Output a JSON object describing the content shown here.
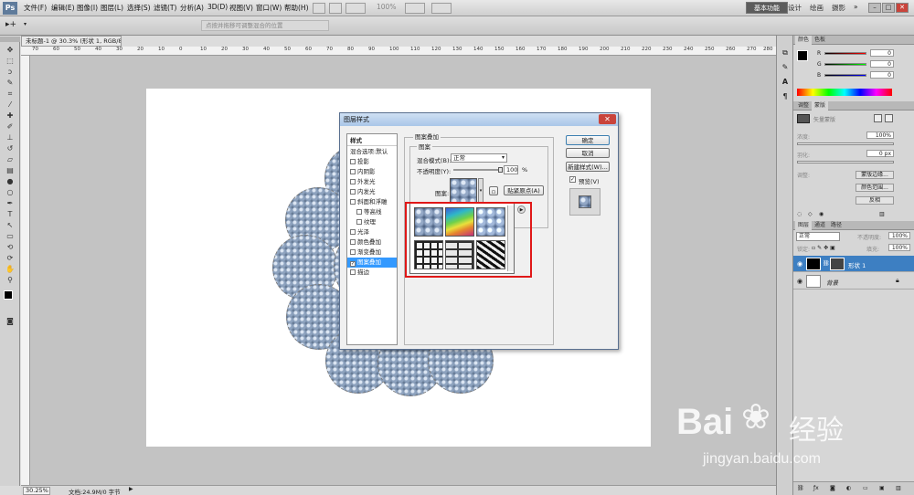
{
  "menubar": {
    "app_logo": "Ps",
    "items": [
      "文件(F)",
      "编辑(E)",
      "图像(I)",
      "图层(L)",
      "选择(S)",
      "滤镜(T)",
      "分析(A)",
      "3D(D)",
      "视图(V)",
      "窗口(W)",
      "帮助(H)"
    ],
    "zoom_value": "100%",
    "workspace": "基本功能",
    "workspace_items": [
      "设计",
      "绘画",
      "摄影"
    ],
    "more": "»"
  },
  "optionsbar": {
    "hint": "点按并拖移可调整混合的位置"
  },
  "toolbar": {
    "tools": [
      "move-tool",
      "marquee-tool",
      "lasso-tool",
      "quick-select-tool",
      "crop-tool",
      "eyedropper-tool",
      "healing-tool",
      "brush-tool",
      "stamp-tool",
      "history-brush-tool",
      "eraser-tool",
      "gradient-tool",
      "blur-tool",
      "dodge-tool",
      "pen-tool",
      "type-tool",
      "path-select-tool",
      "shape-tool",
      "3d-rotate-tool",
      "3d-orbit-tool",
      "hand-tool",
      "zoom-tool"
    ]
  },
  "document": {
    "tab_title": "未标题-1 @ 30.3% (形状 1, RGB/8) *",
    "ruler_ticks": [
      "70",
      "60",
      "50",
      "40",
      "30",
      "20",
      "10",
      "0",
      "10",
      "20",
      "30",
      "40",
      "50",
      "60",
      "70",
      "80",
      "90",
      "100",
      "110",
      "120",
      "130",
      "140",
      "150",
      "160",
      "170",
      "180",
      "190",
      "200",
      "210",
      "220",
      "230",
      "240",
      "250",
      "260",
      "270",
      "280"
    ],
    "zoom": "30.25%",
    "doc_info": "文档:24.9M/0 字节"
  },
  "dialog": {
    "title": "图层样式",
    "close": "✕",
    "styles_header": "样式",
    "blend_default": "混合选项:默认",
    "style_items": [
      {
        "label": "投影",
        "checked": false,
        "indent": false
      },
      {
        "label": "内阴影",
        "checked": false,
        "indent": false
      },
      {
        "label": "外发光",
        "checked": false,
        "indent": false
      },
      {
        "label": "内发光",
        "checked": false,
        "indent": false
      },
      {
        "label": "斜面和浮雕",
        "checked": false,
        "indent": false
      },
      {
        "label": "等高线",
        "checked": false,
        "indent": true
      },
      {
        "label": "纹理",
        "checked": false,
        "indent": true
      },
      {
        "label": "光泽",
        "checked": false,
        "indent": false
      },
      {
        "label": "颜色叠加",
        "checked": false,
        "indent": false
      },
      {
        "label": "渐变叠加",
        "checked": false,
        "indent": false
      },
      {
        "label": "图案叠加",
        "checked": true,
        "indent": false,
        "selected": true
      },
      {
        "label": "描边",
        "checked": false,
        "indent": false
      }
    ],
    "group_title": "图案叠加",
    "sub_group_title": "图案",
    "blend_mode_label": "混合模式(B):",
    "blend_mode_value": "正常",
    "opacity_label": "不透明度(Y):",
    "opacity_value": "100",
    "opacity_fraction": 1.0,
    "percent": "%",
    "pattern_label": "图案:",
    "snap_origin": "贴紧原点(A)",
    "ok": "确定",
    "cancel": "取消",
    "new_style": "新建样式(W)...",
    "preview_label": "预览(V)",
    "preview_checked": true,
    "picker_arrow": "▶"
  },
  "panels": {
    "color_tabs": [
      "颜色",
      "色板"
    ],
    "color_rgb": [
      "R",
      "G",
      "B"
    ],
    "color_values": [
      "0",
      "0",
      "0"
    ],
    "adjust_tabs": [
      "调整",
      "蒙版"
    ],
    "mask_label": "矢量蒙版",
    "density_label": "浓度:",
    "density_value": "100%",
    "feather_label": "羽化:",
    "feather_value": "0 px",
    "refine_label": "调整:",
    "mask_edge": "蒙版边缘...",
    "color_range": "颜色范围...",
    "invert": "反相",
    "layer_tabs": [
      "图层",
      "通道",
      "路径"
    ],
    "layer_blend": "正常",
    "opacity_label": "不透明度:",
    "opacity_value": "100%",
    "lock_label": "锁定:",
    "fill_label": "填充:",
    "fill_value": "100%",
    "layers": [
      {
        "name": "形状 1",
        "selected": true
      },
      {
        "name": "背景",
        "selected": false
      }
    ]
  },
  "colors": {
    "accent_highlight": "#e01818",
    "selection_blue": "#3399ff",
    "pattern_blue": "#6f86a6"
  },
  "watermark": {
    "brand": "Bai",
    "brand2": "经验",
    "url": "jingyan.baidu.com"
  }
}
